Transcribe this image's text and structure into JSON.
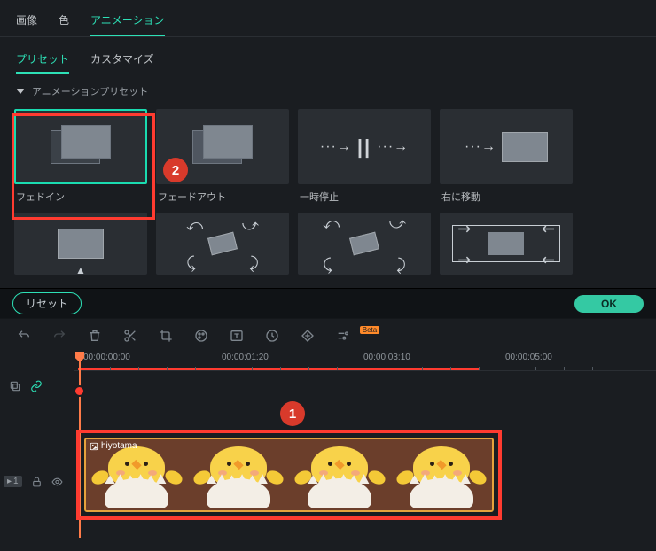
{
  "topTabs": {
    "image": "画像",
    "color": "色",
    "animation": "アニメーション"
  },
  "subTabs": {
    "preset": "プリセット",
    "customize": "カスタマイズ"
  },
  "section": {
    "title": "アニメーションプリセット"
  },
  "presets": {
    "r1": {
      "p1": "フェドイン",
      "p2": "フェードアウト",
      "p3": "一時停止",
      "p4": "右に移動"
    }
  },
  "buttons": {
    "reset": "リセット",
    "ok": "OK"
  },
  "beta": "Beta",
  "timeline": {
    "t0": "00:00:00:00",
    "t1": "00:00:01:20",
    "t2": "00:00:03:10",
    "t3": "00:00:05:00"
  },
  "clip": {
    "name": "hiyotama"
  },
  "trackBadge": "1",
  "annotations": {
    "b1": "1",
    "b2": "2"
  }
}
